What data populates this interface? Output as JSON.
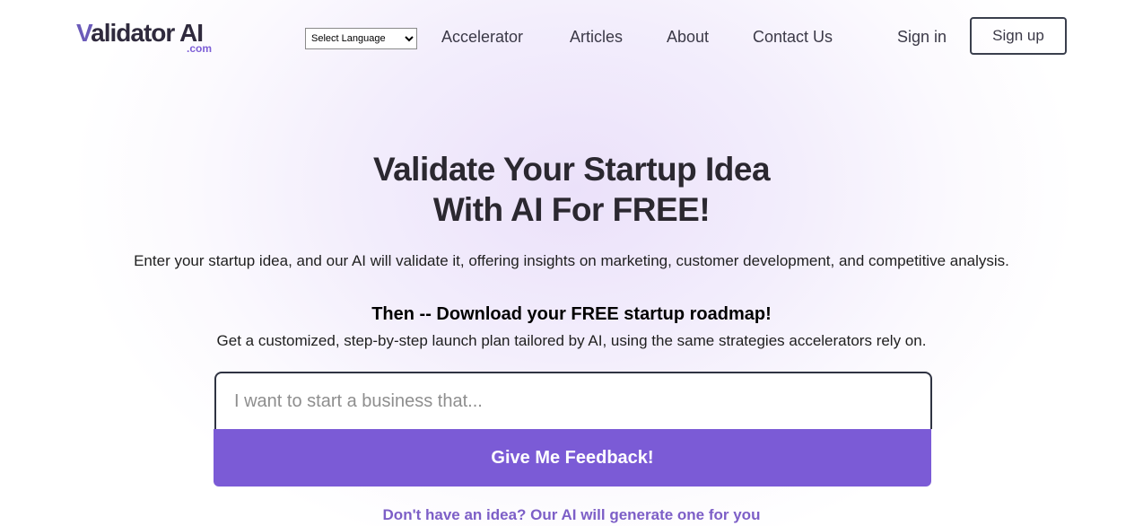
{
  "header": {
    "logo_text": "alidator AI",
    "logo_letter": "V",
    "logo_suffix": ".com",
    "language_select": {
      "selected": "Select Language",
      "options": [
        "Select Language"
      ]
    },
    "nav": [
      {
        "label": "Accelerator"
      },
      {
        "label": "Articles"
      },
      {
        "label": "About"
      },
      {
        "label": "Contact Us"
      }
    ],
    "sign_in_label": "Sign in",
    "sign_up_label": "Sign up"
  },
  "hero": {
    "title_line1": "Validate Your Startup Idea",
    "title_line2": "With AI For FREE!",
    "description": "Enter your startup idea, and our AI will validate it, offering insights on marketing, customer development, and competitive analysis.",
    "then_text": "Then -- Download your FREE startup roadmap!",
    "subtext": "Get a customized, step-by-step launch plan tailored by AI, using the same strategies accelerators rely on."
  },
  "form": {
    "input_value": "",
    "input_placeholder": "I want to start a business that...",
    "submit_label": "Give Me Feedback!",
    "generate_link_label": "Don't have an idea? Our AI will generate one for you"
  },
  "colors": {
    "accent": "#7b5bd6",
    "link": "#7d5fc7",
    "text_dark": "#2b2830",
    "border_dark": "#2f3342"
  }
}
